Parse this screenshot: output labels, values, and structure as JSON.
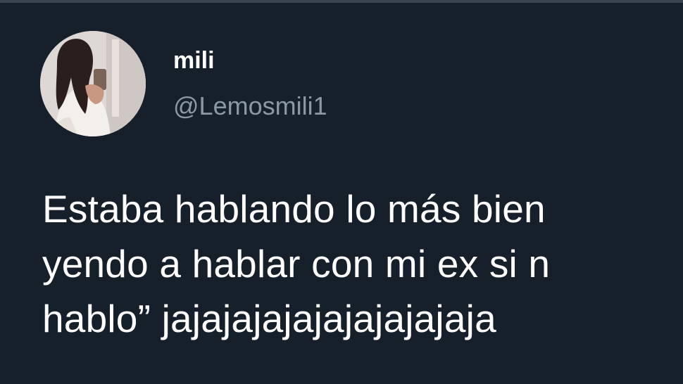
{
  "tweet": {
    "author": {
      "display_name": "mili",
      "handle": "@Lemosmili1",
      "avatar_icon": "profile-photo"
    },
    "text_lines": [
      "Estaba hablando lo más bien",
      "yendo a hablar con mi ex si n",
      "hablo” jajajajajajajajajajaja"
    ]
  },
  "colors": {
    "background": "#15202b",
    "primary_text": "#ffffff",
    "secondary_text": "#8b98a5"
  }
}
